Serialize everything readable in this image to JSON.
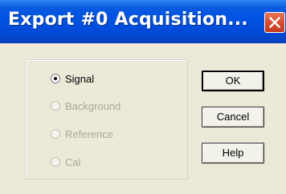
{
  "window": {
    "title": "Export #0  Acquisition..."
  },
  "titlebar": {
    "close_icon": "close-x-icon"
  },
  "options": {
    "items": [
      {
        "label": "Signal",
        "selected": true,
        "enabled": true
      },
      {
        "label": "Background",
        "selected": false,
        "enabled": false
      },
      {
        "label": "Reference",
        "selected": false,
        "enabled": false
      },
      {
        "label": "Cal",
        "selected": false,
        "enabled": false
      }
    ]
  },
  "buttons": {
    "ok_label": "OK",
    "cancel_label": "Cancel",
    "help_label": "Help"
  },
  "colors": {
    "titlebar": "#0054e3",
    "close_button": "#d85032",
    "dialog_background": "#ece9d8",
    "disabled_text": "#aca899"
  }
}
